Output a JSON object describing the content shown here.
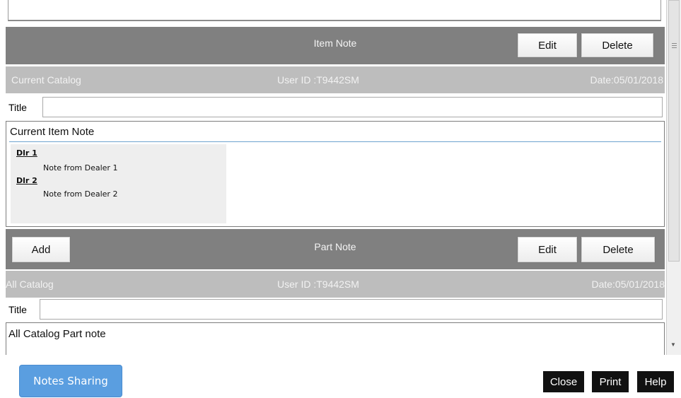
{
  "item_note": {
    "title": "Item Note",
    "edit_label": "Edit",
    "delete_label": "Delete",
    "scope": "Current Catalog",
    "user_id": "User ID :T9442SM",
    "date": "Date:05/01/2018",
    "title_label": "Title",
    "title_value": "",
    "note_heading": "Current Item Note",
    "dealers": [
      {
        "name": "Dlr 1",
        "note": "Note from Dealer 1"
      },
      {
        "name": "Dlr 2",
        "note": "Note from Dealer 2"
      }
    ]
  },
  "part_note": {
    "title": "Part Note",
    "add_label": "Add",
    "edit_label": "Edit",
    "delete_label": "Delete",
    "scope": "All Catalog",
    "user_id": "User ID :T9442SM",
    "date": "Date:05/01/2018",
    "title_label": "Title",
    "title_value": "",
    "note_heading": "All Catalog Part note"
  },
  "footer": {
    "notes_sharing_label": "Notes Sharing",
    "close_label": "Close",
    "print_label": "Print",
    "help_label": "Help"
  },
  "colors": {
    "header_bar": "#808080",
    "meta_bar": "#bdbdbd",
    "share_button": "#5a9ee0",
    "footer_buttons": "#111111"
  },
  "icons": {
    "scroll_grip": "grip-lines-icon",
    "scroll_down": "arrow-down-icon"
  }
}
